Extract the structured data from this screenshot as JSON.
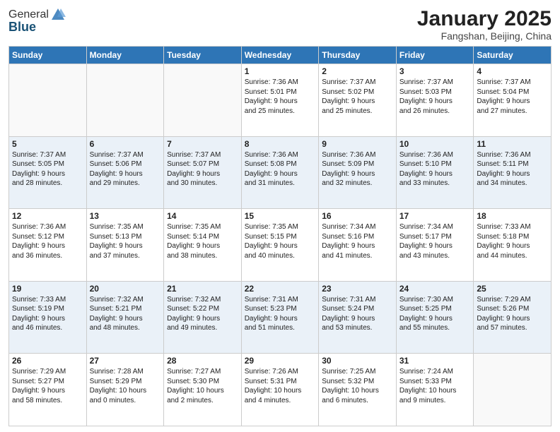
{
  "header": {
    "logo_line1": "General",
    "logo_line2": "Blue",
    "month": "January 2025",
    "location": "Fangshan, Beijing, China"
  },
  "weekdays": [
    "Sunday",
    "Monday",
    "Tuesday",
    "Wednesday",
    "Thursday",
    "Friday",
    "Saturday"
  ],
  "weeks": [
    [
      {
        "day": "",
        "info": ""
      },
      {
        "day": "",
        "info": ""
      },
      {
        "day": "",
        "info": ""
      },
      {
        "day": "1",
        "info": "Sunrise: 7:36 AM\nSunset: 5:01 PM\nDaylight: 9 hours\nand 25 minutes."
      },
      {
        "day": "2",
        "info": "Sunrise: 7:37 AM\nSunset: 5:02 PM\nDaylight: 9 hours\nand 25 minutes."
      },
      {
        "day": "3",
        "info": "Sunrise: 7:37 AM\nSunset: 5:03 PM\nDaylight: 9 hours\nand 26 minutes."
      },
      {
        "day": "4",
        "info": "Sunrise: 7:37 AM\nSunset: 5:04 PM\nDaylight: 9 hours\nand 27 minutes."
      }
    ],
    [
      {
        "day": "5",
        "info": "Sunrise: 7:37 AM\nSunset: 5:05 PM\nDaylight: 9 hours\nand 28 minutes."
      },
      {
        "day": "6",
        "info": "Sunrise: 7:37 AM\nSunset: 5:06 PM\nDaylight: 9 hours\nand 29 minutes."
      },
      {
        "day": "7",
        "info": "Sunrise: 7:37 AM\nSunset: 5:07 PM\nDaylight: 9 hours\nand 30 minutes."
      },
      {
        "day": "8",
        "info": "Sunrise: 7:36 AM\nSunset: 5:08 PM\nDaylight: 9 hours\nand 31 minutes."
      },
      {
        "day": "9",
        "info": "Sunrise: 7:36 AM\nSunset: 5:09 PM\nDaylight: 9 hours\nand 32 minutes."
      },
      {
        "day": "10",
        "info": "Sunrise: 7:36 AM\nSunset: 5:10 PM\nDaylight: 9 hours\nand 33 minutes."
      },
      {
        "day": "11",
        "info": "Sunrise: 7:36 AM\nSunset: 5:11 PM\nDaylight: 9 hours\nand 34 minutes."
      }
    ],
    [
      {
        "day": "12",
        "info": "Sunrise: 7:36 AM\nSunset: 5:12 PM\nDaylight: 9 hours\nand 36 minutes."
      },
      {
        "day": "13",
        "info": "Sunrise: 7:35 AM\nSunset: 5:13 PM\nDaylight: 9 hours\nand 37 minutes."
      },
      {
        "day": "14",
        "info": "Sunrise: 7:35 AM\nSunset: 5:14 PM\nDaylight: 9 hours\nand 38 minutes."
      },
      {
        "day": "15",
        "info": "Sunrise: 7:35 AM\nSunset: 5:15 PM\nDaylight: 9 hours\nand 40 minutes."
      },
      {
        "day": "16",
        "info": "Sunrise: 7:34 AM\nSunset: 5:16 PM\nDaylight: 9 hours\nand 41 minutes."
      },
      {
        "day": "17",
        "info": "Sunrise: 7:34 AM\nSunset: 5:17 PM\nDaylight: 9 hours\nand 43 minutes."
      },
      {
        "day": "18",
        "info": "Sunrise: 7:33 AM\nSunset: 5:18 PM\nDaylight: 9 hours\nand 44 minutes."
      }
    ],
    [
      {
        "day": "19",
        "info": "Sunrise: 7:33 AM\nSunset: 5:19 PM\nDaylight: 9 hours\nand 46 minutes."
      },
      {
        "day": "20",
        "info": "Sunrise: 7:32 AM\nSunset: 5:21 PM\nDaylight: 9 hours\nand 48 minutes."
      },
      {
        "day": "21",
        "info": "Sunrise: 7:32 AM\nSunset: 5:22 PM\nDaylight: 9 hours\nand 49 minutes."
      },
      {
        "day": "22",
        "info": "Sunrise: 7:31 AM\nSunset: 5:23 PM\nDaylight: 9 hours\nand 51 minutes."
      },
      {
        "day": "23",
        "info": "Sunrise: 7:31 AM\nSunset: 5:24 PM\nDaylight: 9 hours\nand 53 minutes."
      },
      {
        "day": "24",
        "info": "Sunrise: 7:30 AM\nSunset: 5:25 PM\nDaylight: 9 hours\nand 55 minutes."
      },
      {
        "day": "25",
        "info": "Sunrise: 7:29 AM\nSunset: 5:26 PM\nDaylight: 9 hours\nand 57 minutes."
      }
    ],
    [
      {
        "day": "26",
        "info": "Sunrise: 7:29 AM\nSunset: 5:27 PM\nDaylight: 9 hours\nand 58 minutes."
      },
      {
        "day": "27",
        "info": "Sunrise: 7:28 AM\nSunset: 5:29 PM\nDaylight: 10 hours\nand 0 minutes."
      },
      {
        "day": "28",
        "info": "Sunrise: 7:27 AM\nSunset: 5:30 PM\nDaylight: 10 hours\nand 2 minutes."
      },
      {
        "day": "29",
        "info": "Sunrise: 7:26 AM\nSunset: 5:31 PM\nDaylight: 10 hours\nand 4 minutes."
      },
      {
        "day": "30",
        "info": "Sunrise: 7:25 AM\nSunset: 5:32 PM\nDaylight: 10 hours\nand 6 minutes."
      },
      {
        "day": "31",
        "info": "Sunrise: 7:24 AM\nSunset: 5:33 PM\nDaylight: 10 hours\nand 9 minutes."
      },
      {
        "day": "",
        "info": ""
      }
    ]
  ]
}
